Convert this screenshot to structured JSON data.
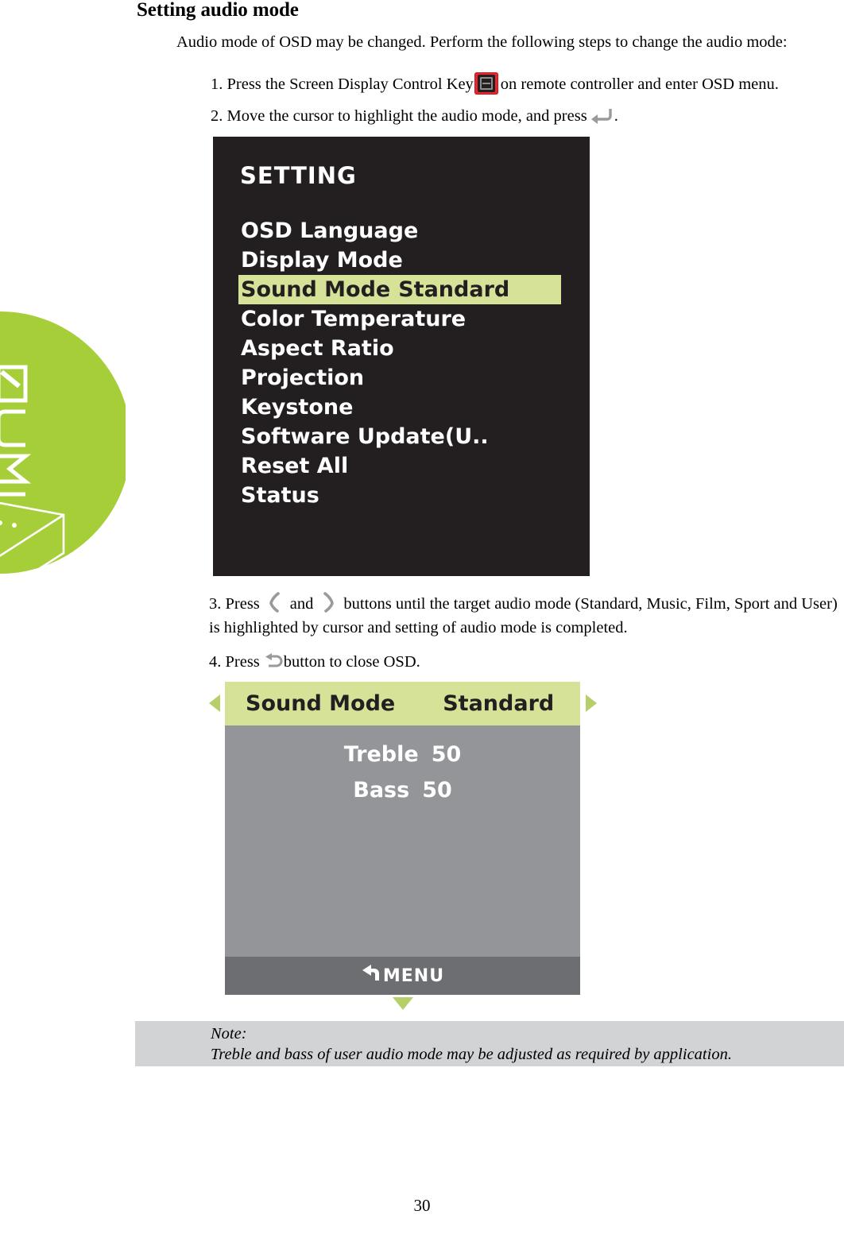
{
  "page": {
    "title": "Setting audio mode",
    "number": "30",
    "intro": "Audio mode of OSD may be changed. Perform the following steps to change the audio mode:"
  },
  "brand": {
    "logo_text": "QUMI",
    "accent_color": "#a6ce39"
  },
  "steps": {
    "step1": {
      "before": "1. Press the Screen Display Control Key",
      "icon": "screen-display-control-key-icon",
      "after": "on remote controller and enter OSD menu."
    },
    "step2": {
      "before": "2. Move the cursor to highlight the audio mode, and press",
      "icon": "enter-arrow-icon",
      "after": "."
    },
    "step3": {
      "before": "3. Press",
      "icon_left": "chevron-left-icon",
      "middle": "and",
      "icon_right": "chevron-right-icon",
      "after": "buttons until the target audio mode (Standard, Music, Film, Sport and User) is highlighted by cursor and setting of audio mode is completed."
    },
    "step4": {
      "before": "4. Press",
      "icon": "back-arrow-icon",
      "after": "button to close OSD."
    }
  },
  "osd_setting": {
    "title": "SETTING",
    "highlight_color": "#d6e298",
    "background_color": "#231f20",
    "items": [
      {
        "label": "OSD Language",
        "value": "",
        "selected": false
      },
      {
        "label": "Display Mode",
        "value": "",
        "selected": false
      },
      {
        "label": "Sound Mode",
        "value": "Standard",
        "selected": true
      },
      {
        "label": "Color Temperature",
        "value": "",
        "selected": false
      },
      {
        "label": "Aspect Ratio",
        "value": "",
        "selected": false
      },
      {
        "label": "Projection",
        "value": "",
        "selected": false
      },
      {
        "label": "Keystone",
        "value": "",
        "selected": false
      },
      {
        "label": "Software Update(U..",
        "value": "",
        "selected": false
      },
      {
        "label": "Reset All",
        "value": "",
        "selected": false
      },
      {
        "label": "Status",
        "value": "",
        "selected": false
      }
    ]
  },
  "osd_sound": {
    "header_label": "Sound Mode",
    "header_value": "Standard",
    "header_color": "#d6e298",
    "body_color": "#939598",
    "footer_color": "#6d6e71",
    "rows": [
      {
        "label": "Treble",
        "value": "50"
      },
      {
        "label": "Bass",
        "value": "50"
      }
    ],
    "footer_label": "MENU",
    "arrow_color": "#b7cf6a"
  },
  "note": {
    "heading": "Note:",
    "text": "Treble and bass of user audio mode may be adjusted as required by application."
  }
}
